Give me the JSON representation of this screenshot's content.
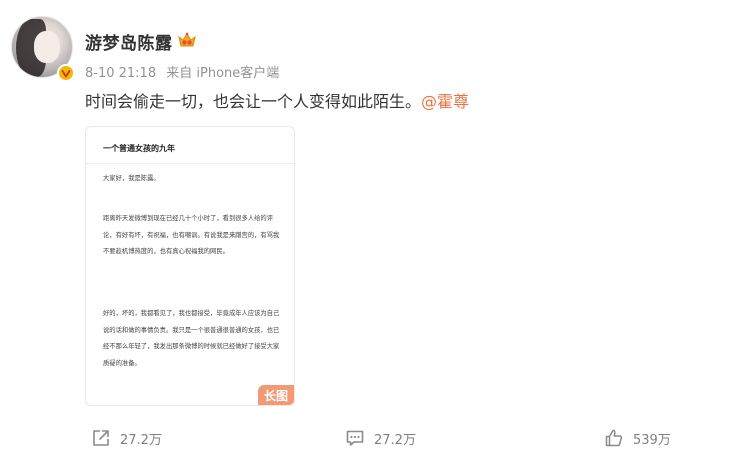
{
  "author": {
    "name": "游梦岛陈露",
    "verified_color": "#f7b500"
  },
  "meta": {
    "time": "8-10 21:18",
    "source": "来自 iPhone客户端"
  },
  "post": {
    "text": "时间会偷走一切，也会让一个人变得如此陌生。",
    "mention": "@霍尊",
    "mention_color": "#eb7340"
  },
  "long_image": {
    "title": "一个普通女孩的九年",
    "paragraphs": [
      "大家好，我是陈露。",
      "距离昨天发微博到现在已经几十个小时了，看到很多人给的评论，有好有坏，有祝福，也有嘲讽。有说我是来蹭宫的，有骂我不要趁机博热度的，也有真心祝福我的网民。",
      "好的，坏的，我都看见了，我也都接受，毕竟成年人应该为自己说的话和做的事情负责。我只是一个很普通很普通的女孩，也已经不那么年轻了，我发出那条微博的时候就已经做好了接受大家质疑的准备。"
    ],
    "badge": "长图"
  },
  "actions": {
    "share": "27.2万",
    "comment": "27.2万",
    "like": "539万"
  }
}
